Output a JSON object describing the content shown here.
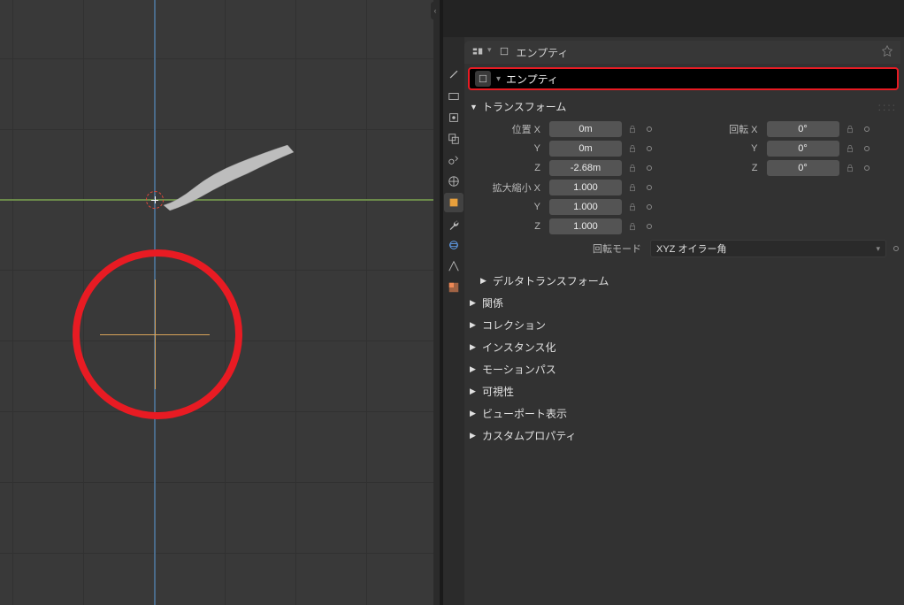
{
  "header": {
    "crumb_label": "エンプティ"
  },
  "name_field": {
    "value": "エンプティ"
  },
  "panels": {
    "transform": "トランスフォーム",
    "delta": "デルタトランスフォーム",
    "relations": "関係",
    "collection": "コレクション",
    "instancing": "インスタンス化",
    "motion": "モーションパス",
    "visibility": "可視性",
    "viewport": "ビューポート表示",
    "custom": "カスタムプロパティ"
  },
  "transform": {
    "location": {
      "label": "位置 X",
      "y": "Y",
      "z": "Z",
      "val_x": "0m",
      "val_y": "0m",
      "val_z": "-2.68m"
    },
    "rotation": {
      "label": "回転 X",
      "y": "Y",
      "z": "Z",
      "val_x": "0°",
      "val_y": "0°",
      "val_z": "0°"
    },
    "scale": {
      "label": "拡大縮小 X",
      "y": "Y",
      "z": "Z",
      "val_x": "1.000",
      "val_y": "1.000",
      "val_z": "1.000"
    },
    "mode_label": "回転モード",
    "mode_value": "XYZ オイラー角"
  }
}
